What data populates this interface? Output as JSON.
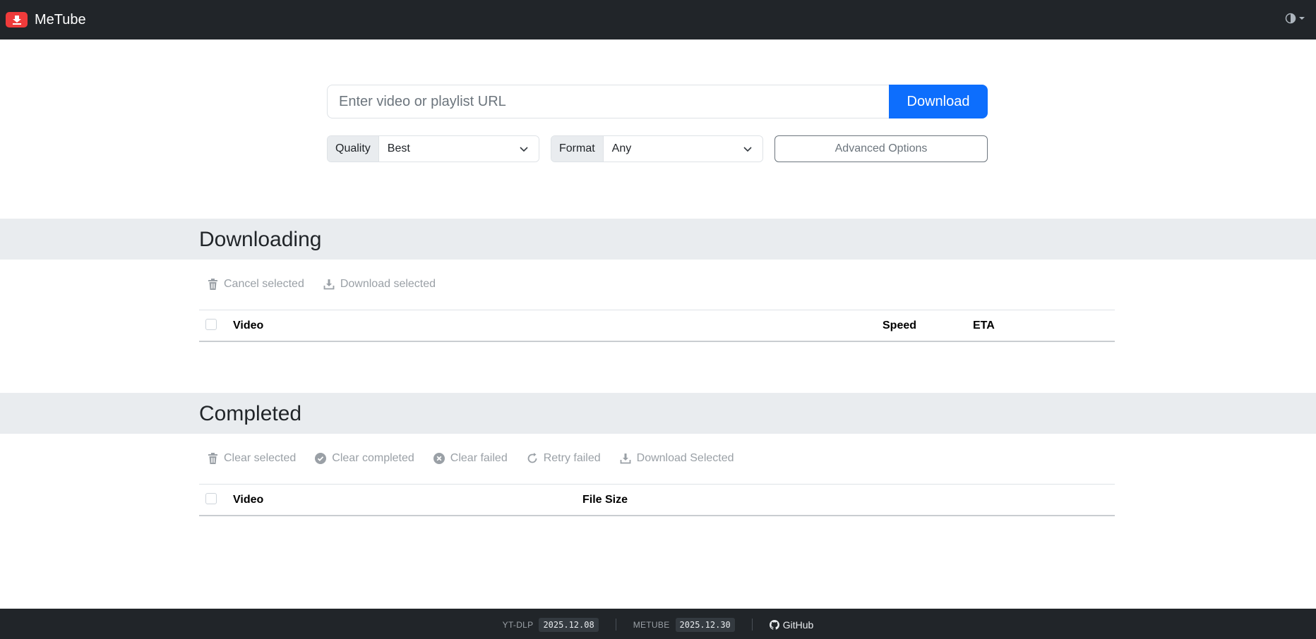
{
  "app": {
    "title": "MeTube"
  },
  "url_bar": {
    "placeholder": "Enter video or playlist URL",
    "value": "",
    "download_label": "Download"
  },
  "options": {
    "quality": {
      "label": "Quality",
      "value": "Best"
    },
    "format": {
      "label": "Format",
      "value": "Any"
    },
    "advanced_label": "Advanced Options"
  },
  "downloading": {
    "title": "Downloading",
    "actions": {
      "cancel_selected": "Cancel selected",
      "download_selected": "Download selected"
    },
    "columns": {
      "video": "Video",
      "speed": "Speed",
      "eta": "ETA"
    }
  },
  "completed": {
    "title": "Completed",
    "actions": {
      "clear_selected": "Clear selected",
      "clear_completed": "Clear completed",
      "clear_failed": "Clear failed",
      "retry_failed": "Retry failed",
      "download_selected": "Download Selected"
    },
    "columns": {
      "video": "Video",
      "file_size": "File Size"
    }
  },
  "footer": {
    "ytdlp_label": "YT-DLP",
    "ytdlp_version": "2025.12.08",
    "metube_label": "METUBE",
    "metube_version": "2025.12.30",
    "github_label": "GitHub"
  },
  "colors": {
    "primary": "#0d6efd",
    "brand": "#ef3b3b",
    "navbar": "#212529",
    "band": "#e9ecef"
  }
}
